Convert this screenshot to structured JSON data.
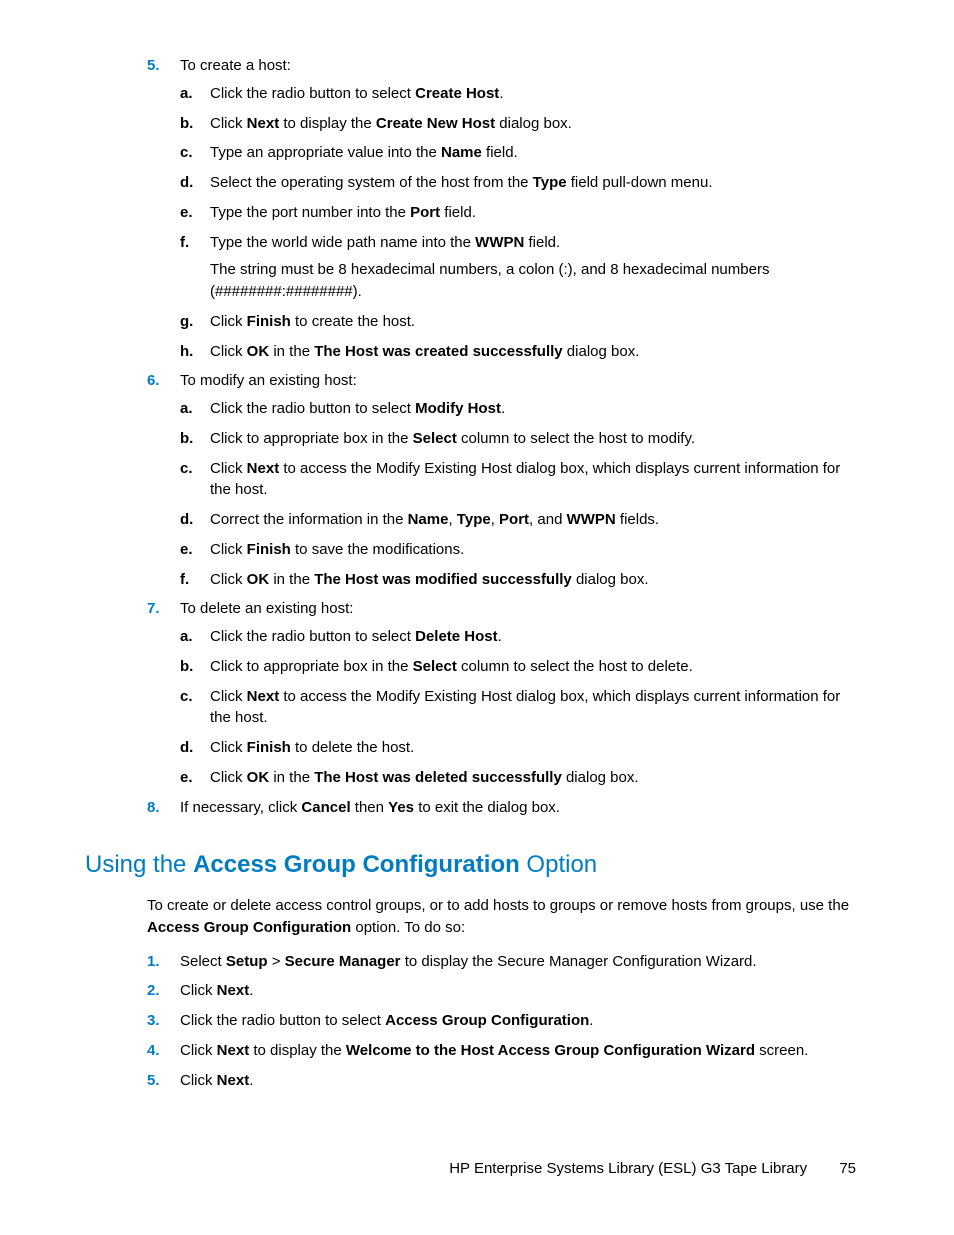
{
  "colors": {
    "accent": "#007cc1"
  },
  "step5": {
    "marker": "5.",
    "text": "To create a host:",
    "a": {
      "m": "a.",
      "t1": "Click the radio button to select ",
      "b1": "Create Host",
      "t2": "."
    },
    "b": {
      "m": "b.",
      "t1": "Click ",
      "b1": "Next",
      "t2": " to display the ",
      "b2": "Create New Host",
      "t3": " dialog box."
    },
    "c": {
      "m": "c.",
      "t1": "Type an appropriate value into the ",
      "b1": "Name",
      "t2": " field."
    },
    "d": {
      "m": "d.",
      "t1": "Select the operating system of the host from the ",
      "b1": "Type",
      "t2": " field pull-down menu."
    },
    "e": {
      "m": "e.",
      "t1": "Type the port number into the ",
      "b1": "Port",
      "t2": " field."
    },
    "f": {
      "m": "f.",
      "t1": "Type the world wide path name into the ",
      "b1": "WWPN",
      "t2": " field.",
      "sub": "The string must be 8 hexadecimal numbers, a colon (:), and 8 hexadecimal numbers (########:########)."
    },
    "g": {
      "m": "g.",
      "t1": "Click ",
      "b1": "Finish",
      "t2": " to create the host."
    },
    "h": {
      "m": "h.",
      "t1": "Click ",
      "b1": "OK",
      "t2": " in the ",
      "b2": "The Host was created successfully",
      "t3": " dialog box."
    }
  },
  "step6": {
    "marker": "6.",
    "text": "To modify an existing host:",
    "a": {
      "m": "a.",
      "t1": "Click the radio button to select ",
      "b1": "Modify Host",
      "t2": "."
    },
    "b": {
      "m": "b.",
      "t1": "Click to appropriate box in the ",
      "b1": "Select",
      "t2": " column to select the host to modify."
    },
    "c": {
      "m": "c.",
      "t1": "Click ",
      "b1": "Next",
      "t2": " to access the Modify Existing Host dialog box, which displays current information for the host."
    },
    "d": {
      "m": "d.",
      "t1": "Correct the information in the ",
      "b1": "Name",
      "t2": ", ",
      "b2": "Type",
      "t3": ", ",
      "b3": "Port",
      "t4": ", and ",
      "b4": "WWPN",
      "t5": " fields."
    },
    "e": {
      "m": "e.",
      "t1": "Click ",
      "b1": "Finish",
      "t2": " to save the modifications."
    },
    "f": {
      "m": "f.",
      "t1": "Click ",
      "b1": "OK",
      "t2": " in the ",
      "b2": "The Host was modified successfully",
      "t3": " dialog box."
    }
  },
  "step7": {
    "marker": "7.",
    "text": "To delete an existing host:",
    "a": {
      "m": "a.",
      "t1": "Click the radio button to select ",
      "b1": "Delete Host",
      "t2": "."
    },
    "b": {
      "m": "b.",
      "t1": "Click to appropriate box in the ",
      "b1": "Select",
      "t2": " column to select the host to delete."
    },
    "c": {
      "m": "c.",
      "t1": "Click ",
      "b1": "Next",
      "t2": " to access the Modify Existing Host dialog box, which displays current information for the host."
    },
    "d": {
      "m": "d.",
      "t1": "Click ",
      "b1": "Finish",
      "t2": " to delete the host."
    },
    "e": {
      "m": "e.",
      "t1": "Click ",
      "b1": "OK",
      "t2": " in the ",
      "b2": "The Host was deleted successfully",
      "t3": " dialog box."
    }
  },
  "step8": {
    "marker": "8.",
    "t1": "If necessary, click ",
    "b1": "Cancel",
    "t2": " then ",
    "b2": "Yes",
    "t3": " to exit the dialog box."
  },
  "section": {
    "title": {
      "t1": "Using the ",
      "b1": "Access Group Configuration",
      "t2": " Option"
    },
    "intro": {
      "t1": "To create or delete access control groups, or to add hosts to groups or remove hosts from groups, use the ",
      "b1": "Access Group Configuration",
      "t2": " option. To do so:"
    },
    "s1": {
      "m": "1.",
      "t1": "Select ",
      "b1": "Setup",
      "t2": " > ",
      "b2": "Secure Manager",
      "t3": " to display the Secure Manager Configuration Wizard."
    },
    "s2": {
      "m": "2.",
      "t1": "Click ",
      "b1": "Next",
      "t2": "."
    },
    "s3": {
      "m": "3.",
      "t1": "Click the radio button to select ",
      "b1": "Access Group Configuration",
      "t2": "."
    },
    "s4": {
      "m": "4.",
      "t1": "Click ",
      "b1": "Next",
      "t2": " to display the ",
      "b2": "Welcome to the Host Access Group Configuration Wizard",
      "t3": " screen."
    },
    "s5": {
      "m": "5.",
      "t1": "Click ",
      "b1": "Next",
      "t2": "."
    }
  },
  "footer": {
    "text": "HP Enterprise Systems Library (ESL) G3 Tape Library",
    "page": "75"
  }
}
